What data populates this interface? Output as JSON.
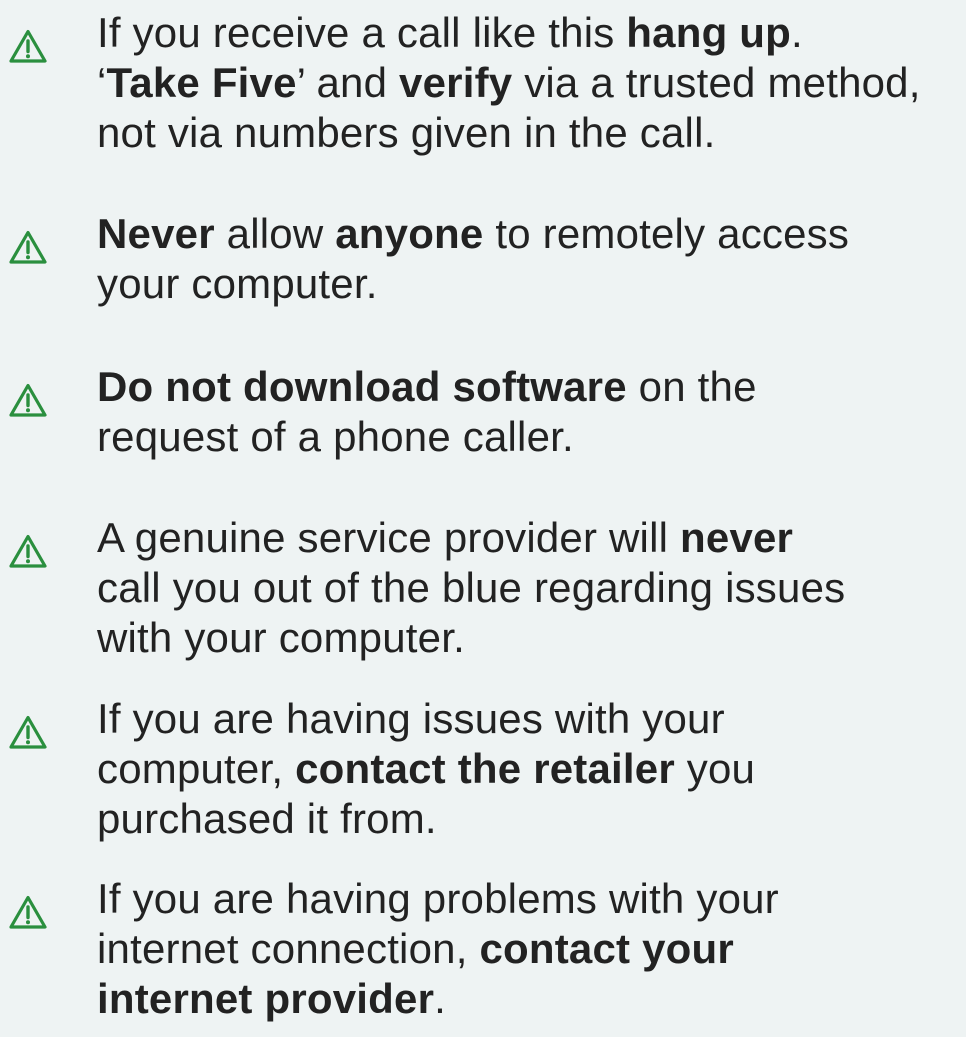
{
  "colors": {
    "background": "#eef3f3",
    "text": "#222222",
    "icon": "#2a8f3e"
  },
  "icon_name": "warning-triangle-icon",
  "tips": [
    {
      "lines": [
        [
          {
            "text": "If you receive a call like this ",
            "bold": false
          },
          {
            "text": "hang up",
            "bold": true
          },
          {
            "text": ".",
            "bold": false
          }
        ],
        [
          {
            "text": "‘",
            "bold": false
          },
          {
            "text": "Take Five",
            "bold": true
          },
          {
            "text": "’ and ",
            "bold": false
          },
          {
            "text": "verify",
            "bold": true
          },
          {
            "text": " via a trusted method,",
            "bold": false
          }
        ],
        [
          {
            "text": "not via numbers given in the call.",
            "bold": false
          }
        ]
      ]
    },
    {
      "lines": [
        [
          {
            "text": "Never",
            "bold": true
          },
          {
            "text": " allow ",
            "bold": false
          },
          {
            "text": "anyone",
            "bold": true
          },
          {
            "text": " to remotely access",
            "bold": false
          }
        ],
        [
          {
            "text": "your computer.",
            "bold": false
          }
        ]
      ]
    },
    {
      "lines": [
        [
          {
            "text": "Do not download software",
            "bold": true
          },
          {
            "text": " on the",
            "bold": false
          }
        ],
        [
          {
            "text": "request of a phone caller.",
            "bold": false
          }
        ]
      ]
    },
    {
      "lines": [
        [
          {
            "text": "A genuine service provider will ",
            "bold": false
          },
          {
            "text": "never",
            "bold": true
          }
        ],
        [
          {
            "text": "call you out of the blue regarding issues",
            "bold": false
          }
        ],
        [
          {
            "text": "with your computer.",
            "bold": false
          }
        ]
      ]
    },
    {
      "lines": [
        [
          {
            "text": "If you are having issues with your",
            "bold": false
          }
        ],
        [
          {
            "text": "computer, ",
            "bold": false
          },
          {
            "text": "contact the retailer",
            "bold": true
          },
          {
            "text": " you",
            "bold": false
          }
        ],
        [
          {
            "text": "purchased it from.",
            "bold": false
          }
        ]
      ]
    },
    {
      "lines": [
        [
          {
            "text": "If you are having problems with your",
            "bold": false
          }
        ],
        [
          {
            "text": "internet connection, ",
            "bold": false
          },
          {
            "text": "contact your",
            "bold": true
          }
        ],
        [
          {
            "text": "internet provider",
            "bold": true
          },
          {
            "text": ".",
            "bold": false
          }
        ]
      ]
    }
  ]
}
